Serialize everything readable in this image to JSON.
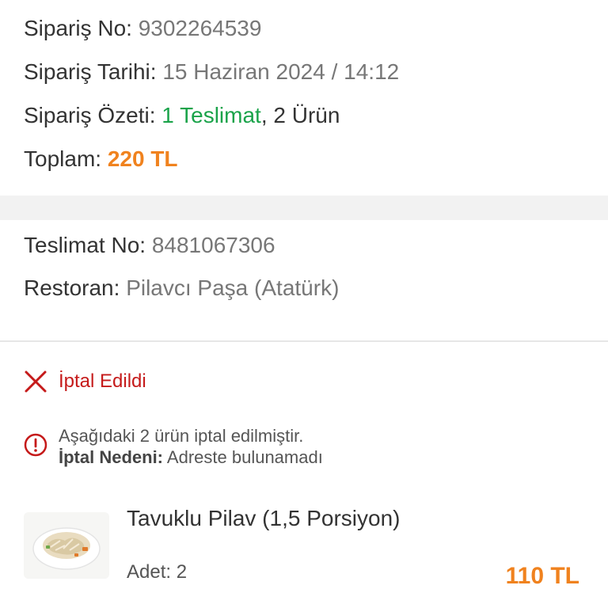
{
  "order": {
    "no_label": "Sipariş No:",
    "no_value": "9302264539",
    "date_label": "Sipariş Tarihi:",
    "date_value": "15 Haziran 2024 / 14:12",
    "summary_label": "Sipariş Özeti:",
    "summary_delivery": "1 Teslimat",
    "summary_items": ", 2 Ürün",
    "total_label": "Toplam:",
    "total_value": "220 TL"
  },
  "delivery": {
    "no_label": "Teslimat No:",
    "no_value": "8481067306",
    "restaurant_label": "Restoran:",
    "restaurant_value": "Pilavcı Paşa (Atatürk)"
  },
  "status": {
    "text": "İptal Edildi",
    "color": "#c51a1a"
  },
  "info": {
    "message": "Aşağıdaki 2 ürün iptal edilmiştir.",
    "reason_label": "İptal Nedeni:",
    "reason_value": "Adreste bulunamadı"
  },
  "product": {
    "name": "Tavuklu Pilav (1,5 Porsiyon)",
    "qty": "Adet: 2",
    "price": "110 TL"
  },
  "colors": {
    "accent_orange": "#f0821e",
    "accent_green": "#1aa34a"
  }
}
